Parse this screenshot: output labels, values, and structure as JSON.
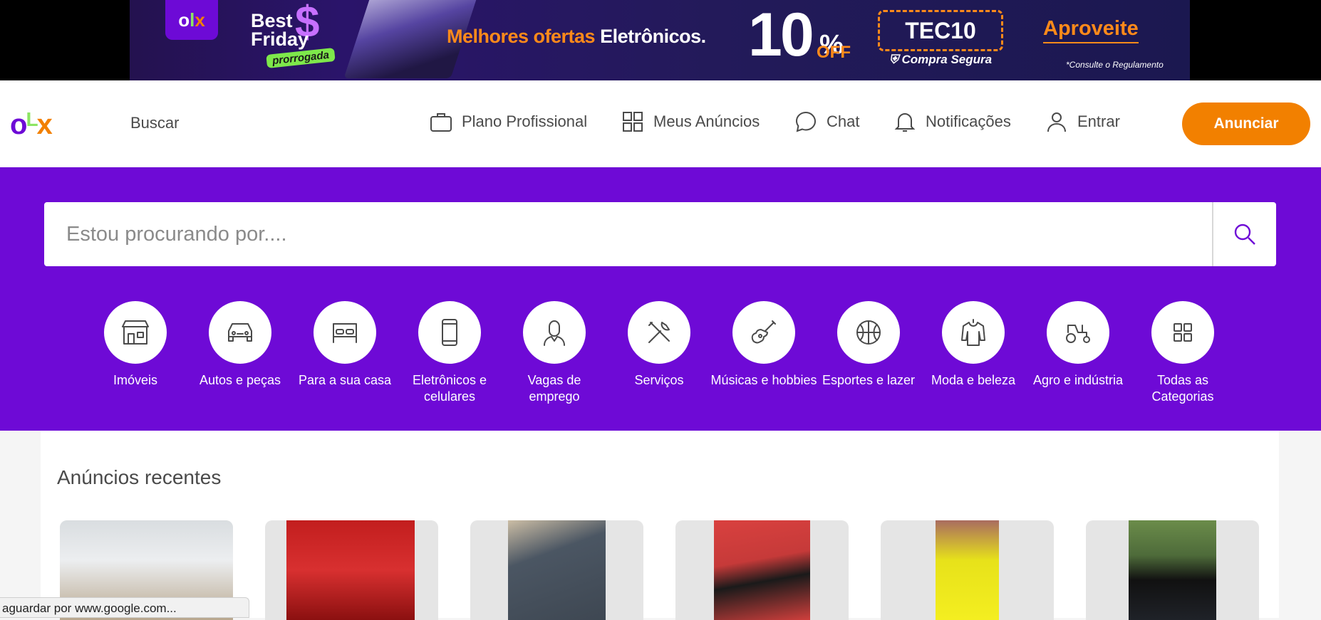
{
  "banner": {
    "olx_logo": "OLX",
    "best": "Best",
    "friday": "Friday",
    "prorrogada": "prorrogada",
    "headline_orange": "Melhores ofertas",
    "headline_white": "Eletrônicos.",
    "percent": "10",
    "percent_sign": "%",
    "off": "OFF",
    "code": "TEC10",
    "compra_segura": "Compra Segura",
    "cta": "Aproveite",
    "disclaimer": "*Consulte o Regulamento"
  },
  "header": {
    "buscar": "Buscar",
    "nav": [
      {
        "label": "Plano Profissional",
        "icon": "briefcase-icon"
      },
      {
        "label": "Meus Anúncios",
        "icon": "grid-icon"
      },
      {
        "label": "Chat",
        "icon": "chat-icon"
      },
      {
        "label": "Notificações",
        "icon": "bell-icon"
      },
      {
        "label": "Entrar",
        "icon": "user-icon"
      }
    ],
    "cta": "Anunciar"
  },
  "search": {
    "placeholder": "Estou procurando por...."
  },
  "categories": [
    {
      "label": "Imóveis",
      "icon": "house-icon"
    },
    {
      "label": "Autos e peças",
      "icon": "car-icon"
    },
    {
      "label": "Para a sua casa",
      "icon": "bed-icon"
    },
    {
      "label": "Eletrônicos e celulares",
      "icon": "phone-icon"
    },
    {
      "label": "Vagas de emprego",
      "icon": "worker-icon"
    },
    {
      "label": "Serviços",
      "icon": "tools-icon"
    },
    {
      "label": "Músicas e hobbies",
      "icon": "guitar-icon"
    },
    {
      "label": "Esportes e lazer",
      "icon": "ball-icon"
    },
    {
      "label": "Moda e beleza",
      "icon": "shirt-icon"
    },
    {
      "label": "Agro e indústria",
      "icon": "tractor-icon"
    },
    {
      "label": "Todas as Categorias",
      "icon": "grid-icon"
    }
  ],
  "recent": {
    "title": "Anúncios recentes"
  },
  "status_bar": "aguardar por www.google.com...",
  "colors": {
    "primary": "#6e0ad6",
    "accent": "#f28000",
    "green": "#8ce563"
  }
}
